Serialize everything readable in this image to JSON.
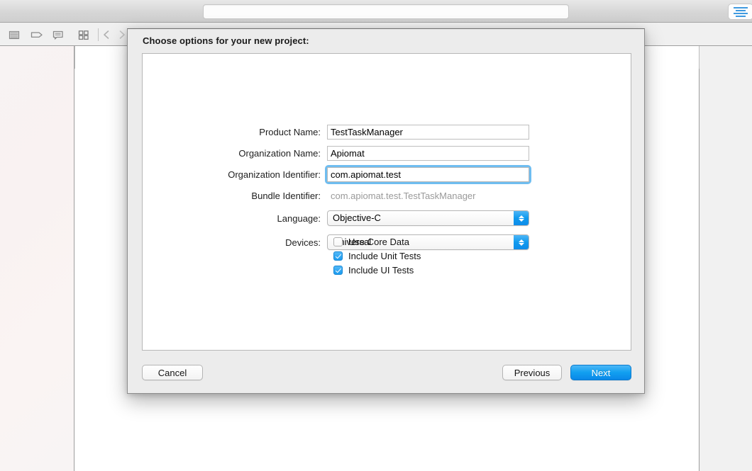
{
  "window": {
    "status_field_value": "",
    "status_field_placeholder": "",
    "toolbar": {
      "icons": [
        {
          "name": "list-view-icon"
        },
        {
          "name": "tag-icon"
        },
        {
          "name": "comment-bubble-icon"
        },
        {
          "name": "grid-view-icon"
        },
        {
          "name": "back-chevron-icon"
        },
        {
          "name": "forward-chevron-icon"
        }
      ],
      "inspector_icon": "lines-inspector-icon"
    }
  },
  "dialog": {
    "title": "Choose options for your new project:",
    "fields": [
      {
        "label": "Product Name:",
        "value": "TestTaskManager",
        "type": "text",
        "focused": false,
        "name": "product-name"
      },
      {
        "label": "Organization Name:",
        "value": "Apiomat",
        "type": "text",
        "focused": false,
        "name": "organization-name"
      },
      {
        "label": "Organization Identifier:",
        "value": "com.apiomat.test",
        "type": "text",
        "focused": true,
        "name": "organization-identifier"
      },
      {
        "label": "Bundle Identifier:",
        "value": "com.apiomat.test.TestTaskManager",
        "type": "static",
        "focused": false,
        "name": "bundle-identifier"
      },
      {
        "label": "Language:",
        "value": "Objective-C",
        "type": "popup",
        "focused": false,
        "name": "language"
      },
      {
        "label": "Devices:",
        "value": "Universal",
        "type": "popup",
        "focused": false,
        "name": "devices"
      }
    ],
    "checkboxes": [
      {
        "label": "Use Core Data",
        "checked": false,
        "name": "use-core-data"
      },
      {
        "label": "Include Unit Tests",
        "checked": true,
        "name": "include-unit-tests"
      },
      {
        "label": "Include UI Tests",
        "checked": true,
        "name": "include-ui-tests"
      }
    ],
    "buttons": {
      "cancel": "Cancel",
      "previous": "Previous",
      "next": "Next"
    }
  },
  "colors": {
    "accent_blue": "#0d8ce9",
    "focus_ring": "#6fbdf0",
    "dialog_bg": "#ececec",
    "navigator_bg": "#f8f3f3"
  }
}
